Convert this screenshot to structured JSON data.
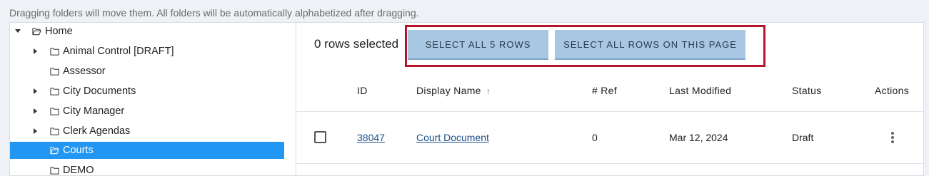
{
  "hint": "Dragging folders will move them. All folders will be automatically alphabetized after dragging.",
  "tree": {
    "items": [
      {
        "label": "Home",
        "expanded": true,
        "has_children": true,
        "icon": "folder-open-icon"
      },
      {
        "label": "Animal Control [DRAFT]",
        "has_children": true,
        "icon": "folder-icon"
      },
      {
        "label": "Assessor",
        "has_children": false,
        "icon": "folder-icon"
      },
      {
        "label": "City Documents",
        "has_children": true,
        "icon": "folder-icon"
      },
      {
        "label": "City Manager",
        "has_children": true,
        "icon": "folder-icon"
      },
      {
        "label": "Clerk Agendas",
        "has_children": true,
        "icon": "folder-icon"
      },
      {
        "label": "Courts",
        "has_children": false,
        "selected": true,
        "icon": "folder-open-icon"
      },
      {
        "label": "DEMO",
        "has_children": false,
        "icon": "folder-icon"
      }
    ],
    "selected_color": "#2196f3"
  },
  "toolbar": {
    "rows_selected": "0 rows selected",
    "select_all_label": "SELECT ALL 5 ROWS",
    "select_page_label": "SELECT ALL ROWS ON THIS PAGE",
    "highlight_color": "#b5152b",
    "button_color": "#a8c7e3"
  },
  "table": {
    "columns": {
      "id": "ID",
      "display_name": "Display Name",
      "sort_indicator": "↑",
      "ref": "# Ref",
      "last_modified": "Last Modified",
      "status": "Status",
      "actions": "Actions"
    },
    "rows": [
      {
        "id": "38047",
        "display_name": "Court Document",
        "ref": "0",
        "last_modified": "Mar 12, 2024",
        "status": "Draft",
        "checked": false
      }
    ]
  }
}
